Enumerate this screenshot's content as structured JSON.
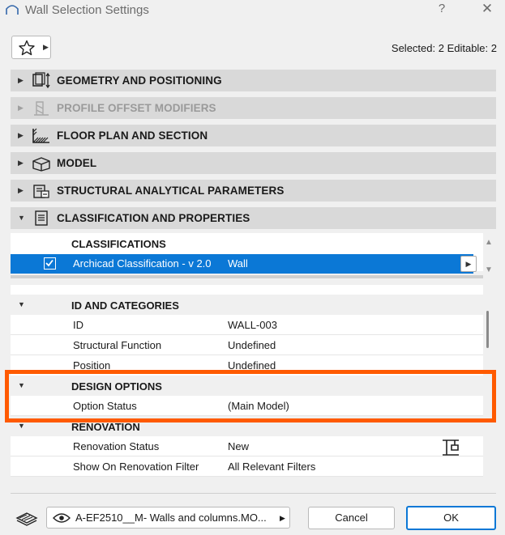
{
  "window": {
    "title": "Wall Selection Settings",
    "help_label": "?",
    "close_label": "✕"
  },
  "toolbar": {
    "selected_text": "Selected: 2 Editable: 2"
  },
  "panels": [
    {
      "label": "GEOMETRY AND POSITIONING",
      "icon": "geometry-icon",
      "expanded": false,
      "disabled": false
    },
    {
      "label": "PROFILE OFFSET MODIFIERS",
      "icon": "profile-offset-icon",
      "expanded": false,
      "disabled": true
    },
    {
      "label": "FLOOR PLAN AND SECTION",
      "icon": "floor-plan-icon",
      "expanded": false,
      "disabled": false
    },
    {
      "label": "MODEL",
      "icon": "model-box-icon",
      "expanded": false,
      "disabled": false
    },
    {
      "label": "STRUCTURAL ANALYTICAL PARAMETERS",
      "icon": "structural-icon",
      "expanded": false,
      "disabled": false
    },
    {
      "label": "CLASSIFICATION AND PROPERTIES",
      "icon": "document-icon",
      "expanded": true,
      "disabled": false
    }
  ],
  "classifications": {
    "header": "CLASSIFICATIONS",
    "row": {
      "system": "Archicad Classification - v 2.0",
      "value": "Wall",
      "checked": true
    }
  },
  "groups": {
    "id_categories": {
      "header": "ID AND CATEGORIES",
      "rows": [
        {
          "key": "ID",
          "value": "WALL-003"
        },
        {
          "key": "Structural Function",
          "value": "Undefined"
        },
        {
          "key": "Position",
          "value": "Undefined"
        }
      ]
    },
    "design_options": {
      "header": "DESIGN OPTIONS",
      "rows": [
        {
          "key": "Option Status",
          "value": "(Main Model)"
        }
      ]
    },
    "renovation": {
      "header": "RENOVATION",
      "rows": [
        {
          "key": "Renovation Status",
          "value": "New"
        },
        {
          "key": "Show On Renovation Filter",
          "value": "All Relevant Filters"
        }
      ]
    }
  },
  "footer": {
    "layer_name": "A-EF2510__M- Walls and columns.MO...",
    "cancel_label": "Cancel",
    "ok_label": "OK"
  },
  "colors": {
    "accent": "#0b78d6",
    "highlight": "#ff5a00",
    "panel_bg": "#d9d9d9"
  }
}
